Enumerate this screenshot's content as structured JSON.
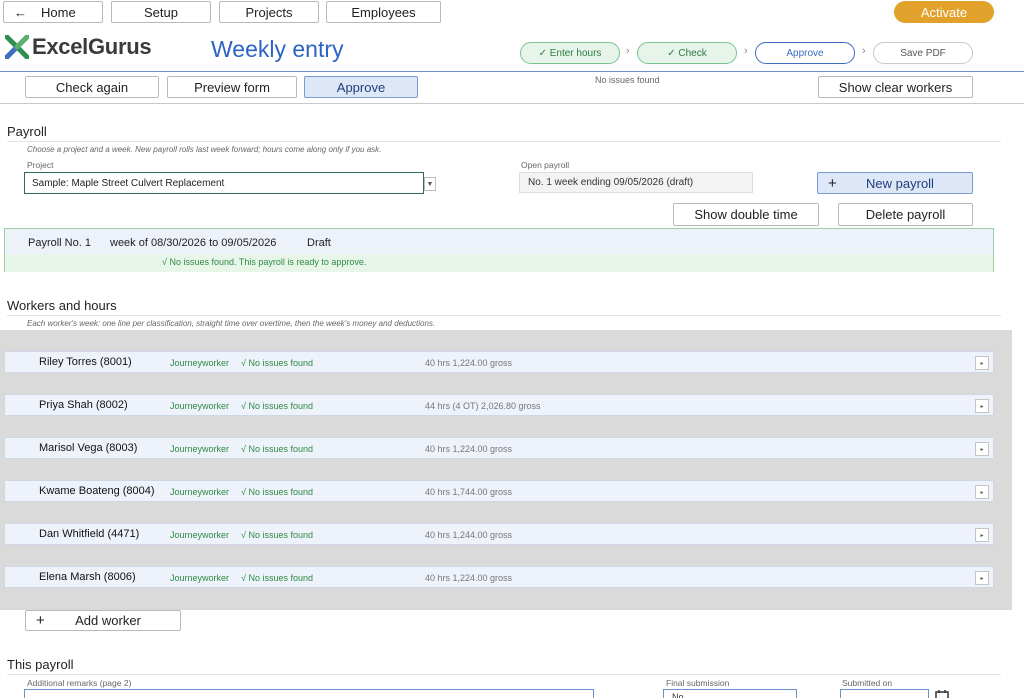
{
  "nav": {
    "back_icon": "arrow-left-icon",
    "home": "Home",
    "setup": "Setup",
    "projects": "Projects",
    "employees": "Employees",
    "activate": "Activate"
  },
  "brand": {
    "logo_icon": "excel-x-logo",
    "name": "ExcelGurus",
    "page_title": "Weekly entry"
  },
  "steps": [
    {
      "label": "✓ Enter hours",
      "state": "done"
    },
    {
      "label": "✓ Check",
      "state": "done"
    },
    {
      "label": "Approve",
      "state": "current"
    },
    {
      "label": "Save PDF",
      "state": "todo"
    }
  ],
  "step_separator": "›",
  "toolbar": {
    "check_again": "Check again",
    "preview_form": "Preview form",
    "approve": "Approve",
    "status": "No issues found",
    "show_clear_workers": "Show clear workers"
  },
  "payroll": {
    "title": "Payroll",
    "help": "Choose a project and a week. New payroll rolls last week forward; hours come along only if you ask.",
    "project_label": "Project",
    "project_value": "Sample: Maple Street Culvert Replacement",
    "open_label": "Open payroll",
    "open_value": "No. 1   week ending 09/05/2026   (draft)",
    "new_payroll": "New payroll",
    "show_double_time": "Show double time",
    "delete_payroll": "Delete payroll",
    "summary_number": "Payroll No. 1",
    "summary_week": "week of 08/30/2026 to 09/05/2026",
    "summary_state": "Draft",
    "summary_ok": "√  No issues found. This payroll is ready to approve."
  },
  "workers": {
    "title": "Workers and hours",
    "help": "Each worker's week: one line per classification, straight time over overtime, then the week's money and deductions.",
    "add_worker": "Add worker",
    "rows": [
      {
        "name": "Riley Torres (8001)",
        "classification": "Journeyworker",
        "status": "√ No issues found",
        "summary": "40 hrs   1,224.00 gross"
      },
      {
        "name": "Priya Shah (8002)",
        "classification": "Journeyworker",
        "status": "√ No issues found",
        "summary": "44 hrs (4 OT)   2,026.80 gross"
      },
      {
        "name": "Marisol Vega (8003)",
        "classification": "Journeyworker",
        "status": "√ No issues found",
        "summary": "40 hrs   1,224.00 gross"
      },
      {
        "name": "Kwame Boateng (8004)",
        "classification": "Journeyworker",
        "status": "√ No issues found",
        "summary": "40 hrs   1,744.00 gross"
      },
      {
        "name": "Dan Whitfield (4471)",
        "classification": "Journeyworker",
        "status": "√ No issues found",
        "summary": "40 hrs   1,244.00 gross"
      },
      {
        "name": "Elena Marsh (8006)",
        "classification": "Journeyworker",
        "status": "√ No issues found",
        "summary": "40 hrs   1,224.00 gross"
      }
    ]
  },
  "this_payroll": {
    "title": "This payroll",
    "remarks_label": "Additional remarks (page 2)",
    "final_label": "Final submission",
    "final_value": "No",
    "submitted_label": "Submitted on",
    "calendar_icon": "calendar-icon"
  },
  "colors": {
    "accent_blue": "#2b64c4",
    "activate": "#e1a12b",
    "ok_green": "#2e8b44"
  }
}
